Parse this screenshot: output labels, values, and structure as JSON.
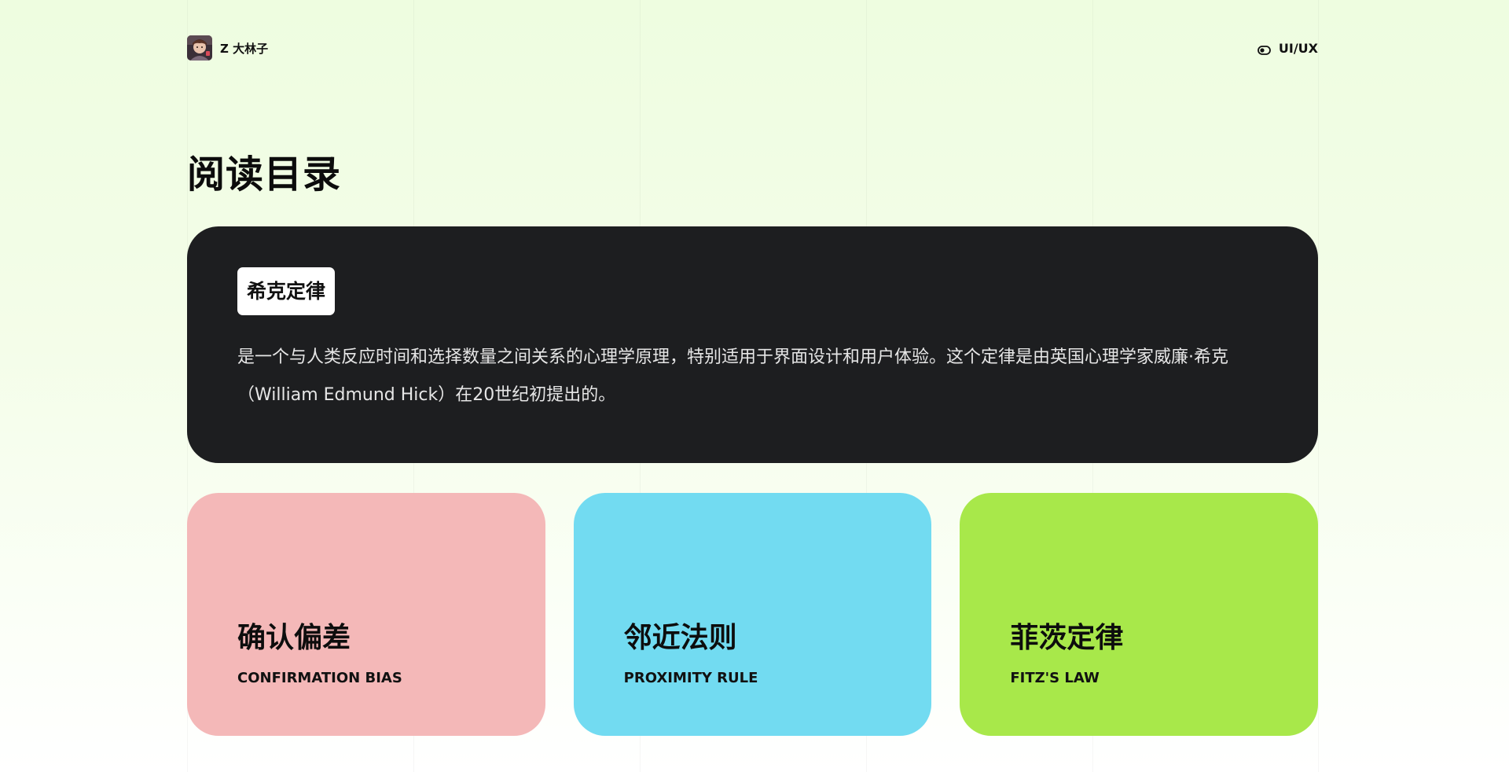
{
  "header": {
    "author_name": "Z 大林子",
    "category_label": "UI/UX"
  },
  "page_title": "阅读目录",
  "featured": {
    "tag": "希克定律",
    "description": "是一个与人类反应时间和选择数量之间关系的心理学原理，特别适用于界面设计和用户体验。这个定律是由英国心理学家威廉·希克（William Edmund Hick）在20世纪初提出的。"
  },
  "cards": [
    {
      "title": "确认偏差",
      "subtitle": "CONFIRMATION BIAS",
      "color": "#f4b8b8"
    },
    {
      "title": "邻近法则",
      "subtitle": "PROXIMITY RULE",
      "color": "#72dbf1"
    },
    {
      "title": "菲茨定律",
      "subtitle": "FITZ'S LAW",
      "color": "#a8e84a"
    }
  ],
  "colors": {
    "featured_background": "#1d1e20",
    "page_background_top": "#eefde0",
    "page_background_bottom": "#ffffff"
  },
  "icons": {
    "category": "toggle-icon"
  }
}
